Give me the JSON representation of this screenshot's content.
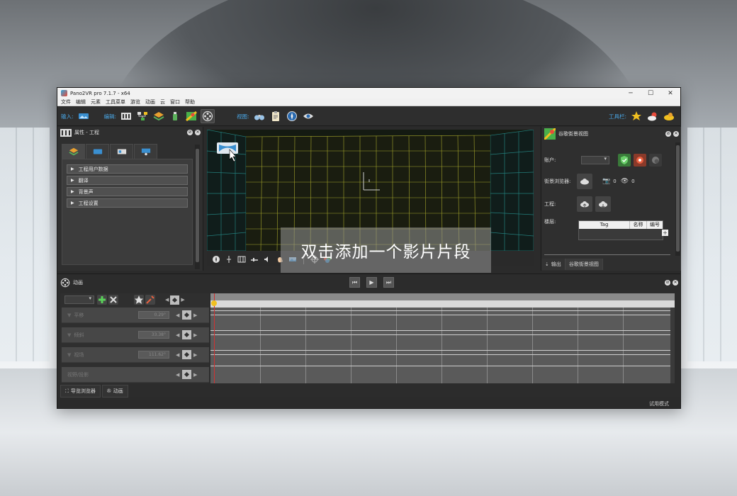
{
  "window": {
    "title": "Pano2VR pro 7.1.7 - x64",
    "minimize": "─",
    "maximize": "☐",
    "close": "✕"
  },
  "menu": [
    "文件",
    "编辑",
    "元素",
    "工具菜单",
    "游览",
    "动画",
    "云",
    "窗口",
    "帮助"
  ],
  "toolbar": {
    "input_label": "输入:",
    "edit_label": "编辑:",
    "view_label": "视图:",
    "toolbar_label": "工具栏:"
  },
  "properties": {
    "title": "属性 - 工程",
    "sections": [
      "工程用户数据",
      "翻译",
      "背景声",
      "工程设置"
    ]
  },
  "google": {
    "title": "谷歌街景视图",
    "account_label": "账户:",
    "browser_label": "街景浏览器:",
    "photo_count": "0",
    "view_count": "0",
    "project_label": "工程:",
    "floor_label": "楼层:",
    "table_headers": [
      "Tag",
      "名称",
      "编号"
    ],
    "tabs": [
      "输出",
      "谷歌街景视图"
    ]
  },
  "animation": {
    "title": "动画",
    "tracks": [
      {
        "label": "平移",
        "value": "0.29°"
      },
      {
        "label": "倾斜",
        "value": "33.38°"
      },
      {
        "label": "视场",
        "value": "111.62°"
      },
      {
        "label": "视野/投影"
      }
    ],
    "hint": "双击添加一个影片片段",
    "bottom_tabs": [
      "导览浏览器",
      "动画"
    ]
  },
  "status": {
    "mode": "试用模式"
  },
  "colors": {
    "accent": "#4aa8e8",
    "grid": "#c8c832",
    "grid_side": "#2aa8a8",
    "cursor": "#d23030"
  }
}
